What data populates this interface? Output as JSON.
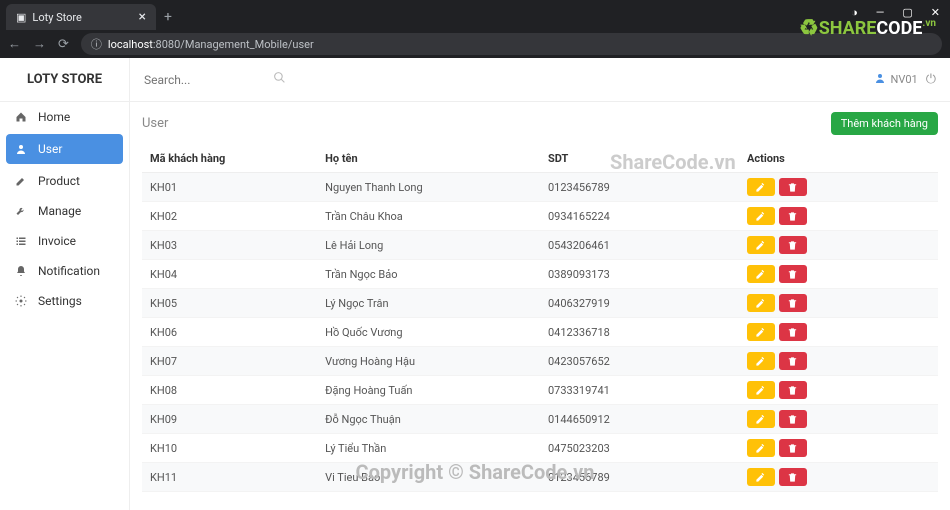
{
  "browser": {
    "tab_title": "Loty Store",
    "url_prefix": "localhost",
    "url_port": ":8080",
    "url_path": "/Management_Mobile/user"
  },
  "header": {
    "brand": "LOTY STORE",
    "search_placeholder": "Search...",
    "username": "NV01"
  },
  "sidebar": {
    "items": [
      {
        "label": "Home",
        "icon": "home"
      },
      {
        "label": "User",
        "icon": "person",
        "active": true
      },
      {
        "label": "Product",
        "icon": "edit"
      },
      {
        "label": "Manage",
        "icon": "wrench"
      },
      {
        "label": "Invoice",
        "icon": "list"
      },
      {
        "label": "Notification",
        "icon": "bell"
      },
      {
        "label": "Settings",
        "icon": "cogs"
      }
    ]
  },
  "page": {
    "title": "User",
    "add_button": "Thêm khách hàng",
    "columns": {
      "id": "Mã khách hàng",
      "name": "Họ tên",
      "phone": "SDT",
      "actions": "Actions"
    },
    "rows": [
      {
        "id": "KH01",
        "name": "Nguyen Thanh Long",
        "phone": "0123456789"
      },
      {
        "id": "KH02",
        "name": "Trần Châu Khoa",
        "phone": "0934165224"
      },
      {
        "id": "KH03",
        "name": "Lê Hải Long",
        "phone": "0543206461"
      },
      {
        "id": "KH04",
        "name": "Trần Ngọc Bảo",
        "phone": "0389093173"
      },
      {
        "id": "KH05",
        "name": "Lý Ngọc Trân",
        "phone": "0406327919"
      },
      {
        "id": "KH06",
        "name": "Hồ Quốc Vương",
        "phone": "0412336718"
      },
      {
        "id": "KH07",
        "name": "Vương Hoàng Hậu",
        "phone": "0423057652"
      },
      {
        "id": "KH08",
        "name": "Đặng Hoàng Tuấn",
        "phone": "0733319741"
      },
      {
        "id": "KH09",
        "name": "Đỗ Ngọc Thuận",
        "phone": "0144650912"
      },
      {
        "id": "KH10",
        "name": "Lý Tiểu Thần",
        "phone": "0475023203"
      },
      {
        "id": "KH11",
        "name": "Vi Tieu Bao",
        "phone": "0123456789"
      }
    ]
  },
  "watermark": {
    "mid": "ShareCode.vn",
    "bottom": "Copyright © ShareCode.vn",
    "logo_share": "SHARE",
    "logo_code": "CODE",
    "logo_vn": ".vn"
  }
}
